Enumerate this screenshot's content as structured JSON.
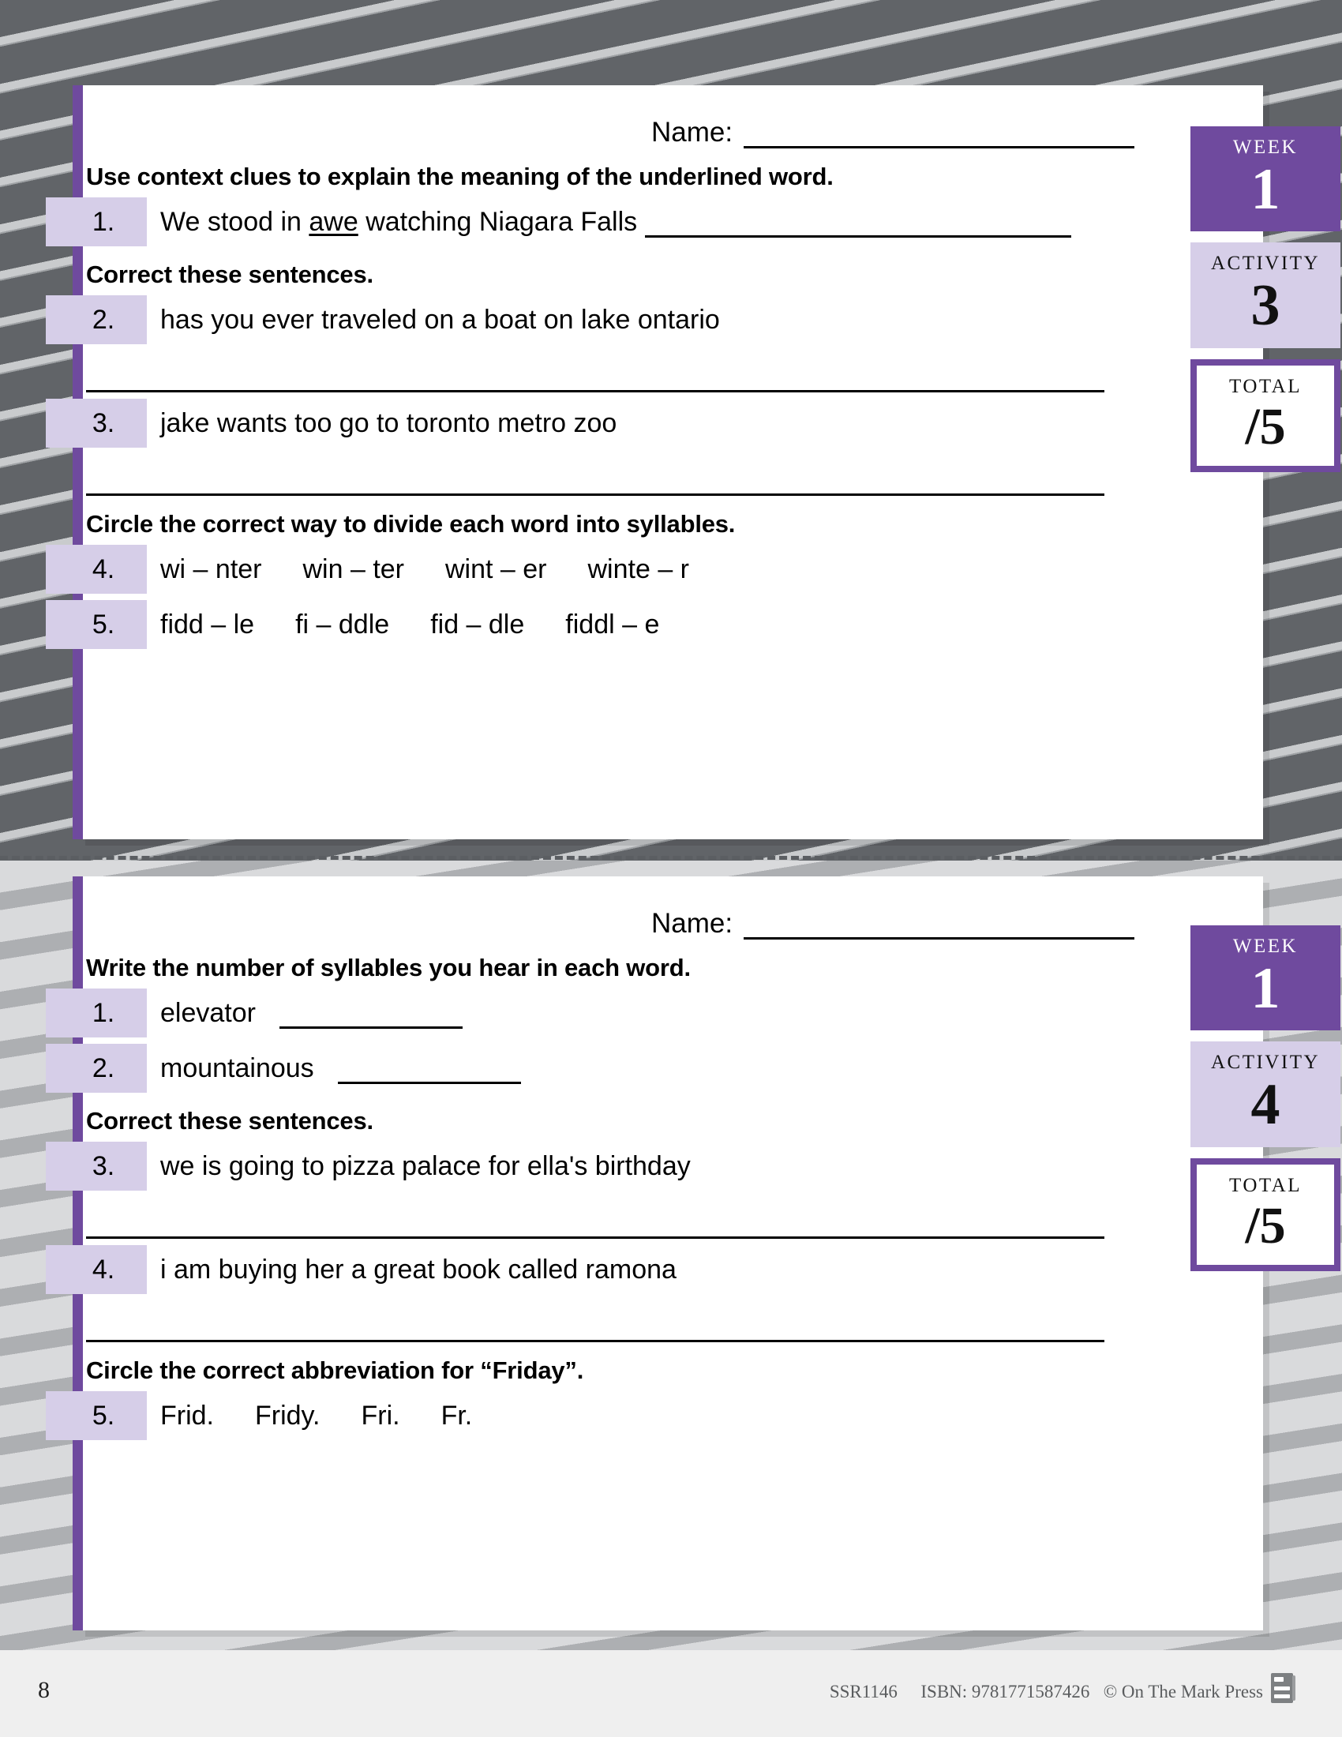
{
  "page": {
    "number": "8",
    "footer": {
      "code": "SSR1146",
      "isbn": "ISBN: 9781771587426",
      "copyright": "© On The Mark Press",
      "icon": "book-icon"
    },
    "colors": {
      "purple": "#6f4a9e",
      "light_purple": "#d6cee8",
      "stripe_dark": "#616468",
      "stripe_light": "#c9cbcd"
    }
  },
  "worksheets": [
    {
      "name_label": "Name:",
      "badges": {
        "week_label": "WEEK",
        "week_value": "1",
        "activity_label": "ACTIVITY",
        "activity_value": "3",
        "total_label": "TOTAL",
        "total_value": "/5"
      },
      "sections": [
        {
          "prompt": "Use context clues to explain the meaning of the underlined word.",
          "items": [
            {
              "num": "1.",
              "pre": "We stood in ",
              "underlined": "awe",
              "post": " watching Niagara Falls",
              "rule": "long"
            }
          ]
        },
        {
          "prompt": "Correct these sentences.",
          "items": [
            {
              "num": "2.",
              "text": "has you ever traveled on a boat on lake ontario",
              "answer_rule": true
            },
            {
              "num": "3.",
              "text": "jake wants too go to toronto metro zoo",
              "answer_rule": true
            }
          ]
        },
        {
          "prompt": "Circle the correct way to divide each word into syllables.",
          "items": [
            {
              "num": "4.",
              "choices": [
                "wi – nter",
                "win – ter",
                "wint – er",
                "winte – r"
              ]
            },
            {
              "num": "5.",
              "choices": [
                "fidd – le",
                "fi – ddle",
                "fid – dle",
                "fiddl – e"
              ]
            }
          ]
        }
      ]
    },
    {
      "name_label": "Name:",
      "badges": {
        "week_label": "WEEK",
        "week_value": "1",
        "activity_label": "ACTIVITY",
        "activity_value": "4",
        "total_label": "TOTAL",
        "total_value": "/5"
      },
      "sections": [
        {
          "prompt": "Write the number of syllables you hear in each word.",
          "items": [
            {
              "num": "1.",
              "text": "elevator",
              "rule": "short"
            },
            {
              "num": "2.",
              "text": "mountainous",
              "rule": "short"
            }
          ]
        },
        {
          "prompt": "Correct these sentences.",
          "items": [
            {
              "num": "3.",
              "text": "we is going to pizza palace for ella's birthday",
              "answer_rule": true
            },
            {
              "num": "4.",
              "text": "i am buying her a great book called ramona",
              "answer_rule": true
            }
          ]
        },
        {
          "prompt": "Circle the correct abbreviation for “Friday”.",
          "items": [
            {
              "num": "5.",
              "choices": [
                "Frid.",
                "Fridy.",
                "Fri.",
                "Fr."
              ]
            }
          ]
        }
      ]
    }
  ]
}
